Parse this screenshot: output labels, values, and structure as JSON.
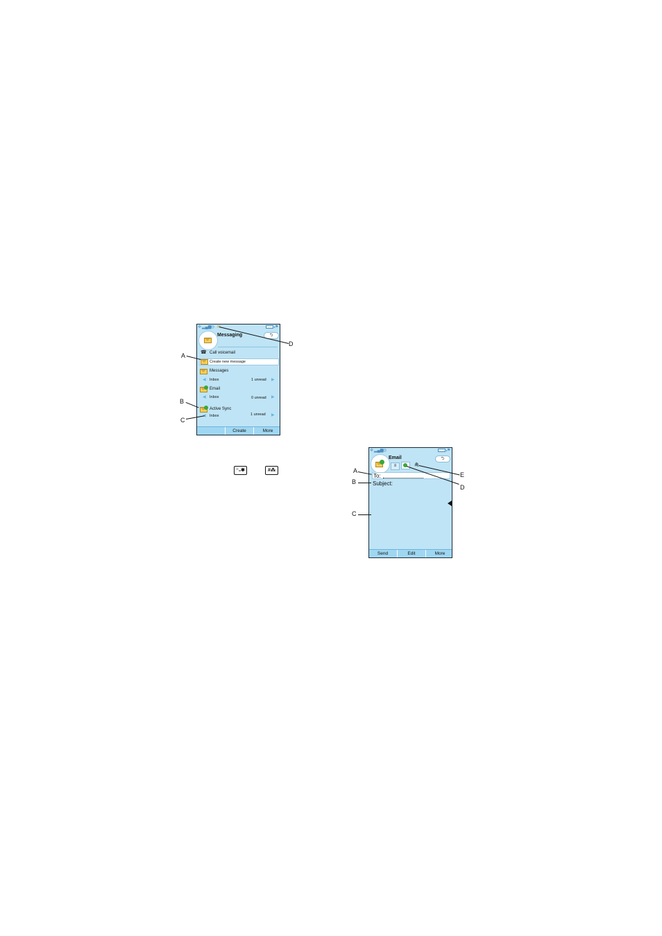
{
  "messaging_screen": {
    "title": "Messaging",
    "back_label": "⮌",
    "items": {
      "call_voicemail": "Call  voicemail",
      "create_new_message": "Create new message",
      "messages": "Messages",
      "messages_inbox": "Inbox",
      "messages_count": "1 unread",
      "email": "Email",
      "email_inbox": "Inbox",
      "email_count": "0 unread",
      "active_sync": "Active Sync",
      "active_sync_inbox": "Inbox",
      "active_sync_count": "1 unread"
    },
    "softkeys": {
      "create": "Create",
      "more": "More"
    },
    "callouts": {
      "a": "A",
      "b": "B",
      "c": "C",
      "d": "D"
    }
  },
  "keys": {
    "star_key": "⁻₀✱",
    "hash_key": "#⁂"
  },
  "email_screen": {
    "title": "Email",
    "back_label": "⮌",
    "tabs": {
      "text": "≡",
      "contact": "●",
      "attach": "🖇"
    },
    "to_label": "To:",
    "subject_label": "Subject:",
    "softkeys": {
      "send": "Send",
      "edit": "Edit",
      "more": "More"
    },
    "callouts": {
      "a": "A",
      "b": "B",
      "c": "C",
      "d": "D",
      "e": "E"
    }
  },
  "colors": {
    "screen_bg": "#bfe4f5",
    "softbar_bg": "#9fd7f2",
    "accent_arrow": "#63b6e6",
    "envelope": "#f4cf5e",
    "status_green": "#3aa83a"
  }
}
